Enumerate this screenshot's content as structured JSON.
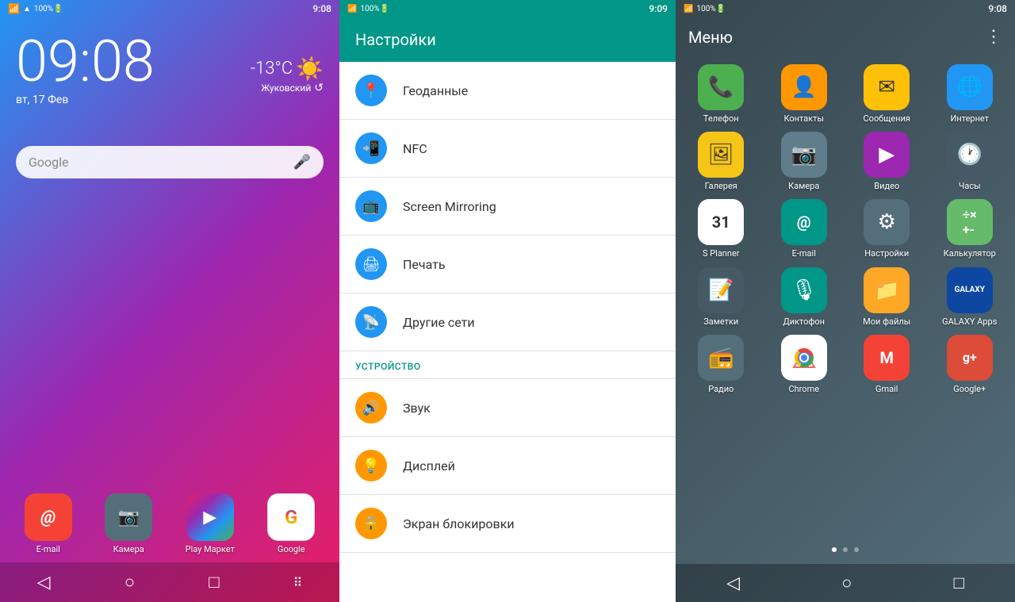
{
  "panel1": {
    "status": {
      "left": "📶 📡 100%",
      "time": "9:08",
      "battery": "🔋100%"
    },
    "time": "09:08",
    "date": "вт, 17 Фев",
    "weather": {
      "temp": "-13°C",
      "city": "Жуковский",
      "icon": "☀️"
    },
    "search_placeholder": "Google",
    "dock": [
      {
        "label": "E-mail",
        "icon": "@",
        "color": "bg-red"
      },
      {
        "label": "Камера",
        "icon": "⬤",
        "color": "bg-darkgrey"
      },
      {
        "label": "Play\nМаркет",
        "icon": "▶",
        "color": "bg-blue"
      },
      {
        "label": "Google",
        "icon": "G",
        "color": "bg-red"
      }
    ],
    "nav": [
      "◁",
      "○",
      "□",
      "⠿"
    ]
  },
  "panel2": {
    "status": {
      "left": "📶 📡 100%",
      "time": "9:09",
      "battery": "🔋100%"
    },
    "title": "Настройки",
    "items": [
      {
        "label": "Геоданные",
        "icon": "📍",
        "icon_color": "icon-blue"
      },
      {
        "label": "NFC",
        "icon": "📲",
        "icon_color": "icon-blue"
      },
      {
        "label": "Screen Mirroring",
        "icon": "📺",
        "icon_color": "icon-blue"
      },
      {
        "label": "Печать",
        "icon": "🖨",
        "icon_color": "icon-blue"
      },
      {
        "label": "Другие сети",
        "icon": "📡",
        "icon_color": "icon-blue"
      }
    ],
    "section_header": "УСТРОЙСТВО",
    "device_items": [
      {
        "label": "Звук",
        "icon": "🔊",
        "icon_color": "icon-orange"
      },
      {
        "label": "Дисплей",
        "icon": "💡",
        "icon_color": "icon-orange"
      },
      {
        "label": "Экран блокировки",
        "icon": "🔒",
        "icon_color": "icon-orange"
      }
    ]
  },
  "panel3": {
    "status": {
      "left": "📶 📡 100%",
      "time": "9:08",
      "battery": "🔋100%"
    },
    "title": "Меню",
    "menu_icon": "⋮",
    "apps": [
      {
        "label": "Телефон",
        "icon": "📞",
        "color": "bg-green"
      },
      {
        "label": "Контакты",
        "icon": "👤",
        "color": "bg-orange"
      },
      {
        "label": "Сообщения",
        "icon": "✉",
        "color": "bg-amber"
      },
      {
        "label": "Интернет",
        "icon": "🌐",
        "color": "bg-blue"
      },
      {
        "label": "Галерея",
        "icon": "🖼",
        "color": "bg-yellow"
      },
      {
        "label": "Камера",
        "icon": "📷",
        "color": "bg-grey"
      },
      {
        "label": "Видео",
        "icon": "▶",
        "color": "bg-purple"
      },
      {
        "label": "Часы",
        "icon": "🕐",
        "color": "bg-darkgrey"
      },
      {
        "label": "S Planner",
        "icon": "31",
        "color": "bg-calendar"
      },
      {
        "label": "E-mail",
        "icon": "@",
        "color": "bg-teal"
      },
      {
        "label": "Настройки",
        "icon": "⚙",
        "color": "bg-settings-app"
      },
      {
        "label": "Калькулятор",
        "icon": "⊞",
        "color": "bg-calculator"
      },
      {
        "label": "Заметки",
        "icon": "📝",
        "color": "bg-darkgrey"
      },
      {
        "label": "Диктофон",
        "icon": "🎙",
        "color": "bg-teal"
      },
      {
        "label": "Мои файлы",
        "icon": "📁",
        "color": "bg-myfiles"
      },
      {
        "label": "GALAXY Apps",
        "icon": "G",
        "color": "bg-galaxy"
      },
      {
        "label": "Радио",
        "icon": "📻",
        "color": "bg-radio"
      },
      {
        "label": "Chrome",
        "icon": "⬤",
        "color": "bg-chrome"
      },
      {
        "label": "Gmail",
        "icon": "M",
        "color": "bg-gmail"
      },
      {
        "label": "Google+",
        "icon": "g+",
        "color": "bg-gplus"
      }
    ],
    "dots": [
      true,
      false,
      false
    ],
    "nav": [
      "◁",
      "○",
      "□"
    ]
  }
}
